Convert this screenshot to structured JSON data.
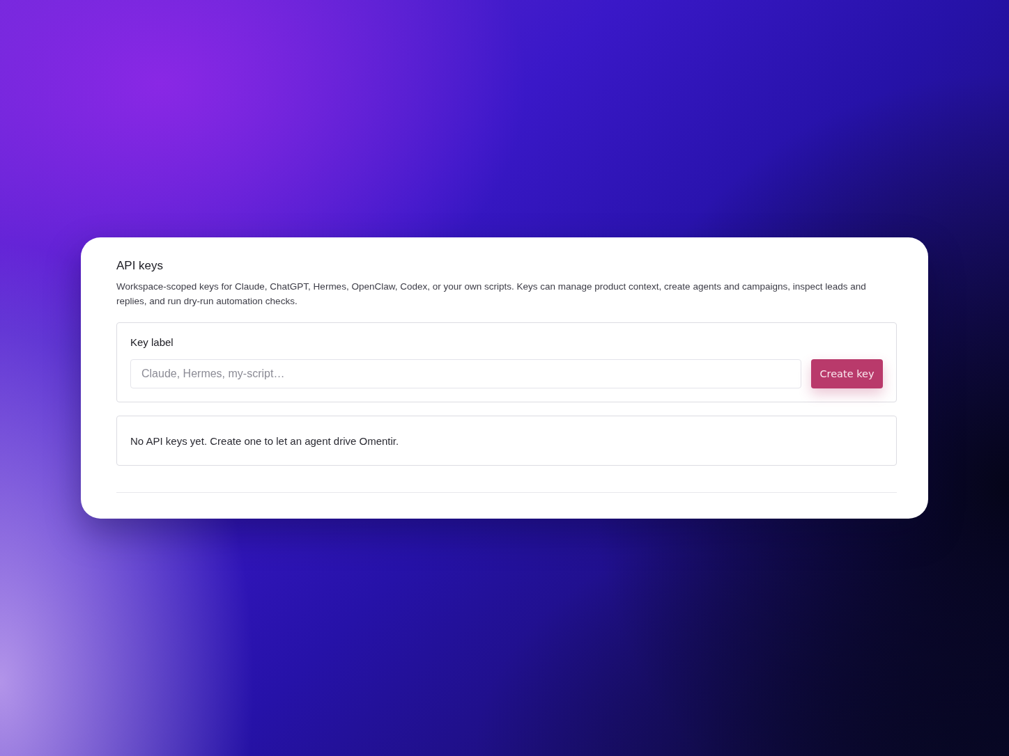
{
  "panel": {
    "title": "API keys",
    "description": "Workspace-scoped keys for Claude, ChatGPT, Hermes, OpenClaw, Codex, or your own scripts. Keys can manage product context, create agents and campaigns, inspect leads and replies, and run dry-run automation checks."
  },
  "form": {
    "label": "Key label",
    "input": {
      "placeholder": "Claude, Hermes, my-script…"
    },
    "button": "Create key"
  },
  "empty_state": "No API keys yet. Create one to let an agent drive Omentir."
}
